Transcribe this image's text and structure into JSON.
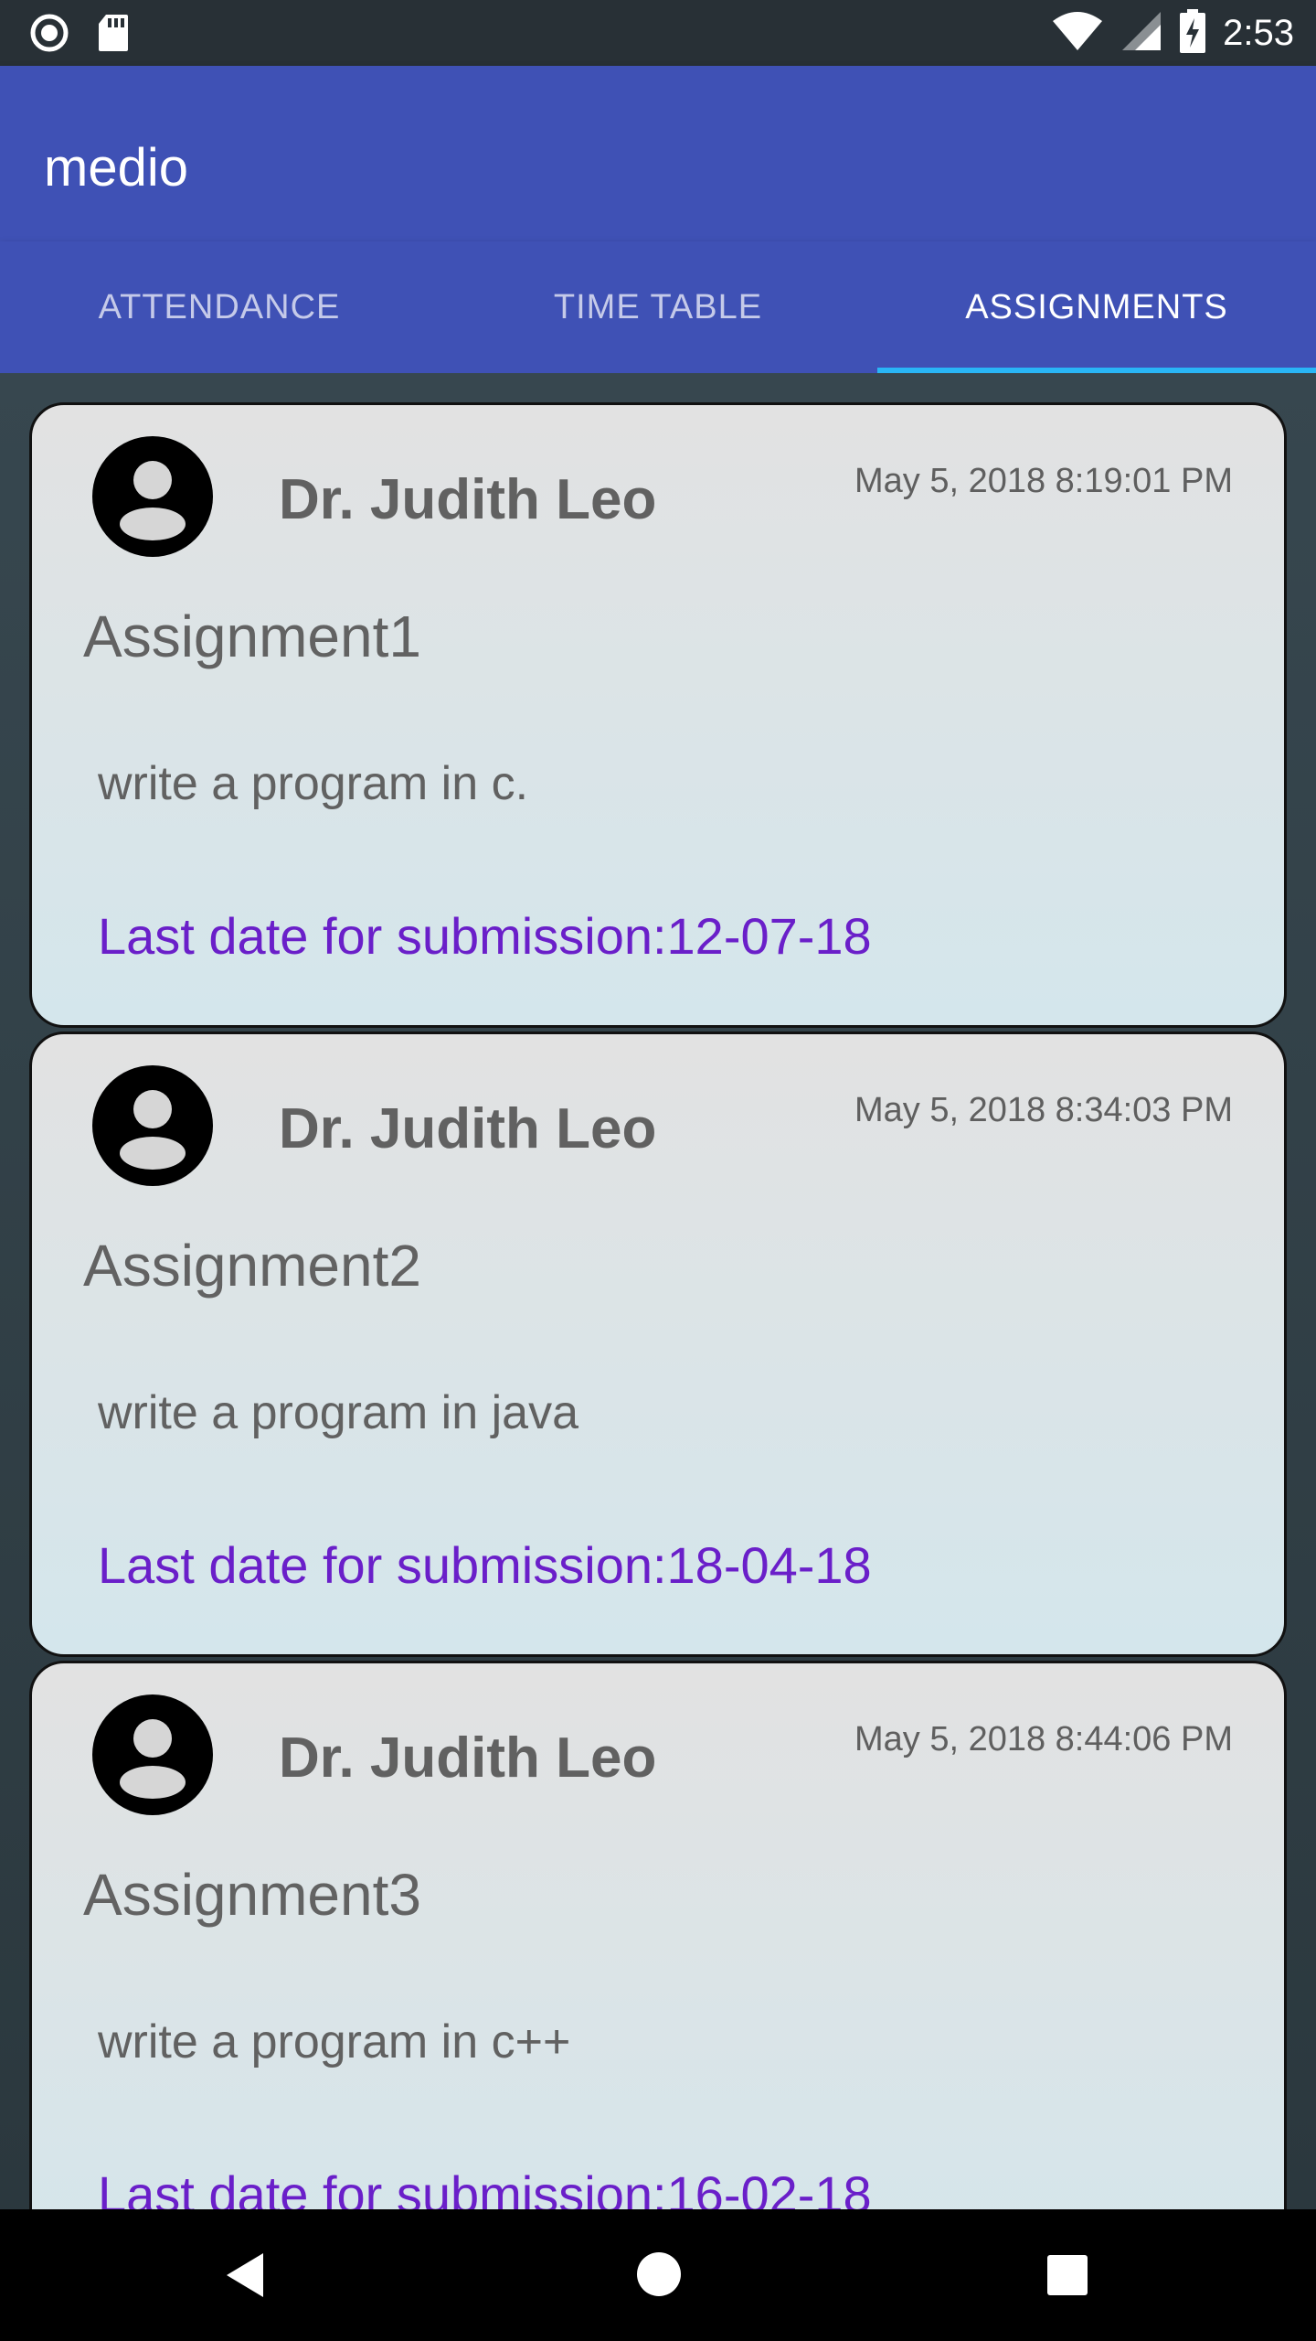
{
  "status_bar": {
    "time": "2:53"
  },
  "app_bar": {
    "title": "medio"
  },
  "tabs": [
    {
      "label": "ATTENDANCE",
      "active": false
    },
    {
      "label": "TIME TABLE",
      "active": false
    },
    {
      "label": "ASSIGNMENTS",
      "active": true
    }
  ],
  "assignments": [
    {
      "teacher": "Dr. Judith Leo",
      "timestamp": "May 5, 2018 8:19:01 PM",
      "title": "Assignment1",
      "description": "write a program in c.",
      "due": "Last date for submission:12-07-18"
    },
    {
      "teacher": "Dr. Judith Leo",
      "timestamp": "May 5, 2018 8:34:03 PM",
      "title": "Assignment2",
      "description": "write a program in java",
      "due": "Last date for submission:18-04-18"
    },
    {
      "teacher": "Dr. Judith Leo",
      "timestamp": "May 5, 2018 8:44:06 PM",
      "title": "Assignment3",
      "description": "write a program in c++",
      "due": "Last date for submission:16-02-18"
    }
  ],
  "colors": {
    "primary": "#3f51b5",
    "tab_indicator": "#29b6f6",
    "due_text": "#6a1fc9"
  },
  "icons": {
    "status_left": [
      "record-icon",
      "sd-card-icon"
    ],
    "status_right": [
      "wifi-icon",
      "signal-icon",
      "battery-charging-icon"
    ],
    "avatar": "account-circle-icon",
    "nav": [
      "back-icon",
      "home-icon",
      "recents-icon"
    ]
  }
}
